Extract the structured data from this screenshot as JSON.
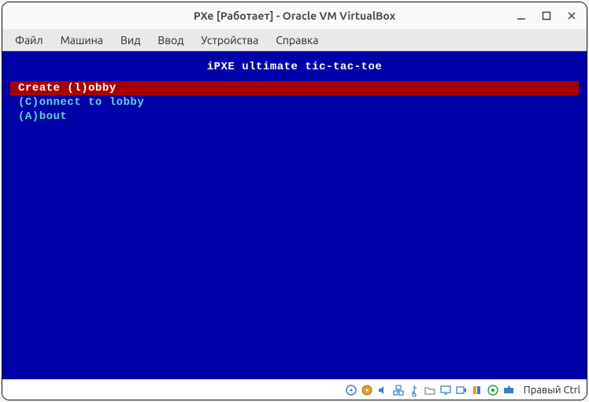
{
  "window": {
    "title": "PXe [Работает] - Oracle VM VirtualBox"
  },
  "menubar": {
    "items": [
      "Файл",
      "Машина",
      "Вид",
      "Ввод",
      "Устройства",
      "Справка"
    ]
  },
  "vm": {
    "title": "iPXE ultimate tic-tac-toe",
    "menu": [
      {
        "label": "Create (l)obby",
        "selected": true
      },
      {
        "label": "(C)onnect to lobby",
        "selected": false
      },
      {
        "label": "(A)bout",
        "selected": false
      }
    ]
  },
  "statusbar": {
    "host_key": "Правый Ctrl",
    "icons": [
      "hard-disk-icon",
      "optical-disk-icon",
      "audio-icon",
      "network-icon",
      "usb-icon",
      "shared-folder-icon",
      "display-icon",
      "recording-icon",
      "cpu-icon",
      "mouse-icon",
      "keyboard-icon"
    ]
  }
}
